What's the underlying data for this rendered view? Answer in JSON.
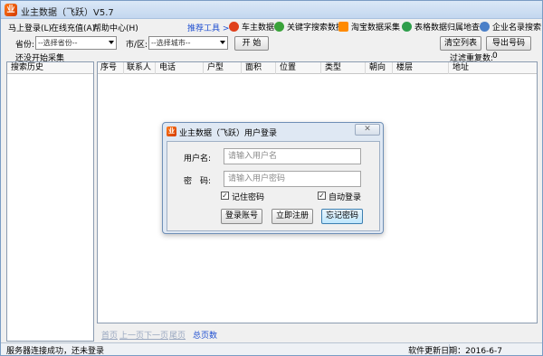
{
  "window": {
    "title": "业主数据（飞跃）V5.7",
    "logo_char": "业",
    "minimize": "–",
    "maximize": "□",
    "close": "✕"
  },
  "menu": {
    "items": [
      "马上登录(L)",
      "在线充值(A)",
      "帮助中心(H)"
    ],
    "tools_label": "推荐工具 >>",
    "tools": [
      {
        "label": "车主数据",
        "icon": "car-data-icon"
      },
      {
        "label": "关键字搜索数据",
        "icon": "keyword-search-icon"
      },
      {
        "label": "淘宝数据采集",
        "icon": "taobao-icon"
      },
      {
        "label": "表格数据归属地查询",
        "icon": "table-location-icon"
      },
      {
        "label": "企业名录搜索",
        "icon": "enterprise-search-icon"
      }
    ]
  },
  "filters": {
    "province_label": "省份:",
    "province_value": "--选择省份--",
    "city_label": "市/区:",
    "city_value": "--选择城市--",
    "start_button": "开 始",
    "clear_button": "清空列表",
    "export_button": "导出号码",
    "status_text": "还没开始采集",
    "dedupe_label": "过滤重复数:",
    "dedupe_count": "0"
  },
  "left_panel": {
    "header": "搜索历史"
  },
  "grid": {
    "columns": [
      "序号",
      "联系人",
      "电话",
      "户型",
      "面积",
      "位置",
      "类型",
      "朝向",
      "楼层",
      "地址"
    ]
  },
  "pager": {
    "first": "首页",
    "prev": "上一页",
    "next": "下一页",
    "last": "尾页",
    "total": "总页数"
  },
  "status": {
    "left": "服务器连接成功，还未登录",
    "right": "软件更新日期：2016-6-7"
  },
  "login_dialog": {
    "title": "业主数据（飞跃）用户登录",
    "close": "✕",
    "username_label": "用户名:",
    "username_placeholder": "请输入用户名",
    "password_label": "密　码:",
    "password_placeholder": "请输入用户密码",
    "remember_label": "记住密码",
    "remember_checked": "✓",
    "auto_login_label": "自动登录",
    "auto_login_checked": "✓",
    "login_button": "登录账号",
    "register_button": "立即注册",
    "forgot_button": "忘记密码"
  }
}
